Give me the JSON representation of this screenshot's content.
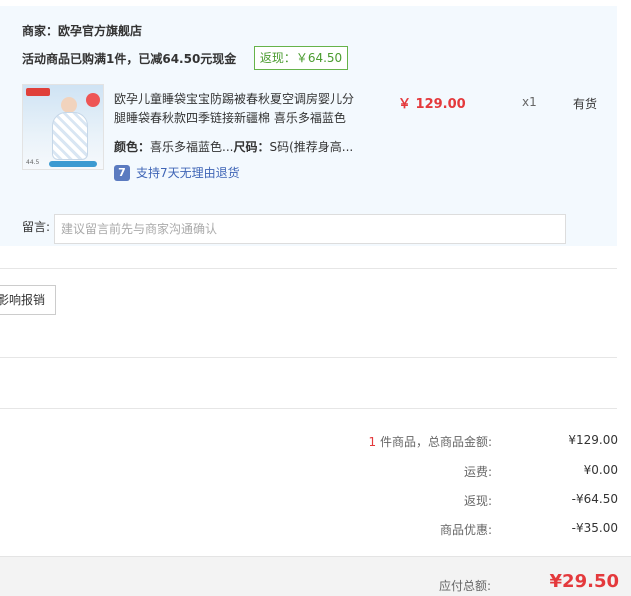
{
  "store": {
    "merchant": "商家：欧孕官方旗舰店",
    "promo": "活动商品已购满1件，已减64.50元现金",
    "rebate_tag": "返现：￥64.50"
  },
  "product": {
    "title": "欧孕儿童睡袋宝宝防踢被春秋夏空调房婴儿分腿睡袋春秋款四季链接新疆棉 喜乐多福蓝色",
    "price": "￥ 129.00",
    "quantity": "x1",
    "stock": "有货",
    "color_label": "颜色：",
    "color_value": "喜乐多福蓝色...",
    "size_label": "尺码：",
    "size_value": "S码(推荐身高...",
    "returns_icon_text": "7",
    "returns_text": "支持7天无理由退货",
    "image_price_text": "44.5"
  },
  "message": {
    "label": "留言:",
    "placeholder": "建议留言前先与商家沟通确认"
  },
  "invoice": {
    "button_label": "影响报销"
  },
  "summary": {
    "items_count": "1",
    "items_label": " 件商品，总商品金额:",
    "items_value": "¥129.00",
    "shipping_label": "运费:",
    "shipping_value": "¥0.00",
    "rebate_label": "返现:",
    "rebate_value": "-¥64.50",
    "discount_label": "商品优惠:",
    "discount_value": "-¥35.00"
  },
  "total": {
    "label": "应付总额:",
    "value": "¥29.50"
  },
  "colors": {
    "price_red": "#e4393c",
    "rebate_green": "#4a9b2f",
    "store_bg": "#f3f9fe",
    "link_blue": "#3f65b6"
  }
}
